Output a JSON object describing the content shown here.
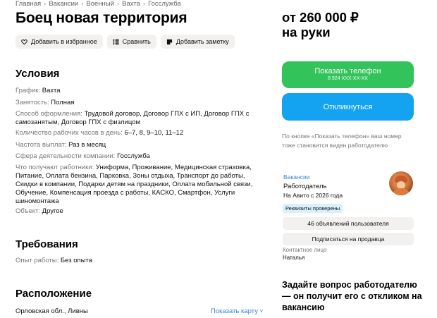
{
  "breadcrumbs": [
    "Главная",
    "Вакансии",
    "Военный",
    "Вахта",
    "Госслужба"
  ],
  "title": "Боец новая территория",
  "actions": {
    "favorite": "Добавить в избранное",
    "compare": "Сравнить",
    "note": "Добавить заметку"
  },
  "conditions": {
    "heading": "Условия",
    "items": [
      {
        "label": "График:",
        "value": "Вахта"
      },
      {
        "label": "Занятость:",
        "value": "Полная"
      },
      {
        "label": "Способ оформления:",
        "value": "Трудовой договор, Договор ГПХ с ИП, Договор ГПХ с самозанятым, Договор ГПХ с физлицом"
      },
      {
        "label": "Количество рабочих часов в день:",
        "value": "6–7, 8, 9–10, 11–12"
      },
      {
        "label": "Частота выплат:",
        "value": "Раз в месяц"
      },
      {
        "label": "Сфера деятельности компании:",
        "value": "Госслужба"
      },
      {
        "label": "Что получают работники:",
        "value": "Униформа, Проживание, Медицинская страховка, Питание, Оплата бензина, Парковка, Зоны отдыха, Транспорт до работы, Скидки в компании, Подарки детям на праздники, Оплата мобильной связи, Обучение, Компенсация проезда с работы, КАСКО, Смартфон, Услуги шиномонтажа"
      },
      {
        "label": "Объект:",
        "value": "Другое"
      }
    ]
  },
  "requirements": {
    "heading": "Требования",
    "items": [
      {
        "label": "Опыт работы:",
        "value": "Без опыта"
      }
    ]
  },
  "location": {
    "heading": "Расположение",
    "address": "Орловская обл., Ливны",
    "show_map": "Показать карту"
  },
  "sidebar": {
    "price": "от 260 000 ₽",
    "price_note": "на руки",
    "phone_button": "Показать телефон",
    "phone_masked": "8 924 XXX-XX-XX",
    "respond_button": "Откликнуться",
    "note": "По кнопке «Показать телефон» ваш номер тоже становится виден работодателю",
    "seller": {
      "vacancies_link": "Вакансии",
      "name": "Работодатель",
      "since": "На Авито с 2026 года",
      "verified_badge": "Реквизиты проверены",
      "ads_button": "46 объявлений пользователя",
      "subscribe_button": "Подписаться на продавца"
    },
    "contact_label": "Контактное лицо",
    "contact_name": "Наталья",
    "ask_heading": "Задайте вопрос работодателю — он получит его с откликом на вакансию"
  },
  "colors": {
    "green": "#32c45a",
    "blue": "#13a3f0",
    "link": "#3b82d6",
    "badge": "#d9f0fb"
  }
}
